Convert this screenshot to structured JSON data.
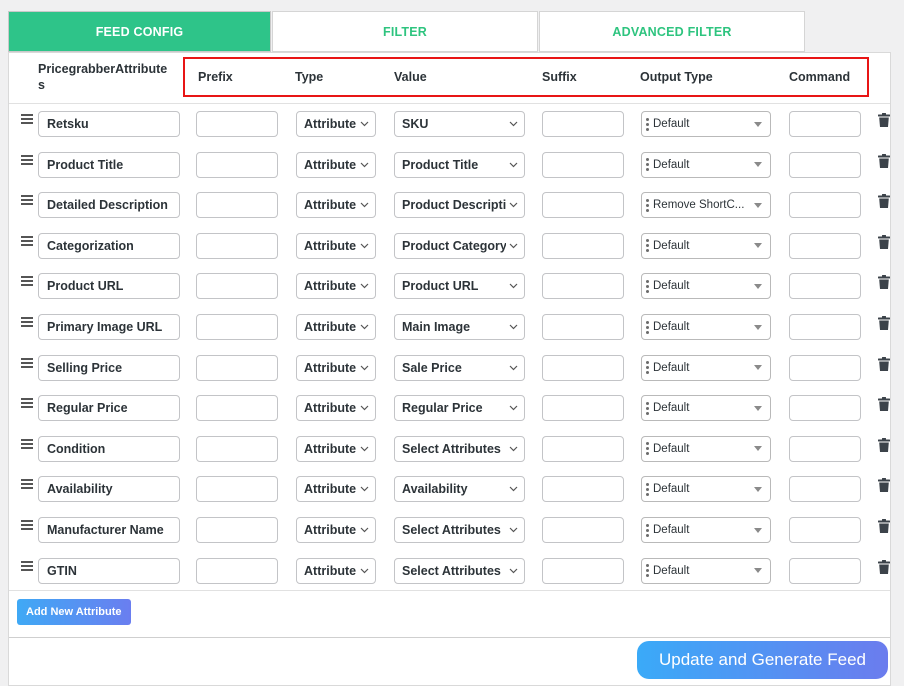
{
  "tabs": [
    {
      "label": "FEED CONFIG",
      "active": true
    },
    {
      "label": "FILTER",
      "active": false
    },
    {
      "label": "ADVANCED FILTER",
      "active": false
    }
  ],
  "columns": {
    "attribute": "PricegrabberAttribute\ns",
    "prefix": "Prefix",
    "type": "Type",
    "value": "Value",
    "suffix": "Suffix",
    "output_type": "Output Type",
    "command": "Command"
  },
  "rows": [
    {
      "attribute": "Retsku",
      "prefix": "",
      "type": "Attribute",
      "value": "SKU",
      "suffix": "",
      "output_type": "Default",
      "command": ""
    },
    {
      "attribute": "Product Title",
      "prefix": "",
      "type": "Attribute",
      "value": "Product Title",
      "suffix": "",
      "output_type": "Default",
      "command": ""
    },
    {
      "attribute": "Detailed Description",
      "prefix": "",
      "type": "Attribute",
      "value": "Product Description",
      "suffix": "",
      "output_type": "Remove ShortC...",
      "command": ""
    },
    {
      "attribute": "Categorization",
      "prefix": "",
      "type": "Attribute",
      "value": "Product Category",
      "suffix": "",
      "output_type": "Default",
      "command": ""
    },
    {
      "attribute": "Product URL",
      "prefix": "",
      "type": "Attribute",
      "value": "Product URL",
      "suffix": "",
      "output_type": "Default",
      "command": ""
    },
    {
      "attribute": "Primary Image URL",
      "prefix": "",
      "type": "Attribute",
      "value": "Main Image",
      "suffix": "",
      "output_type": "Default",
      "command": ""
    },
    {
      "attribute": "Selling Price",
      "prefix": "",
      "type": "Attribute",
      "value": "Sale Price",
      "suffix": "",
      "output_type": "Default",
      "command": ""
    },
    {
      "attribute": "Regular Price",
      "prefix": "",
      "type": "Attribute",
      "value": "Regular Price",
      "suffix": "",
      "output_type": "Default",
      "command": ""
    },
    {
      "attribute": "Condition",
      "prefix": "",
      "type": "Attribute",
      "value": "Select Attributes",
      "suffix": "",
      "output_type": "Default",
      "command": ""
    },
    {
      "attribute": "Availability",
      "prefix": "",
      "type": "Attribute",
      "value": "Availability",
      "suffix": "",
      "output_type": "Default",
      "command": ""
    },
    {
      "attribute": "Manufacturer Name",
      "prefix": "",
      "type": "Attribute",
      "value": "Select Attributes",
      "suffix": "",
      "output_type": "Default",
      "command": ""
    },
    {
      "attribute": "GTIN",
      "prefix": "",
      "type": "Attribute",
      "value": "Select Attributes",
      "suffix": "",
      "output_type": "Default",
      "command": ""
    }
  ],
  "buttons": {
    "add_attribute": "Add New Attribute",
    "generate": "Update and Generate Feed"
  },
  "icons": {
    "drag": "drag-handle-icon",
    "trash": "trash-icon",
    "chevron": "chevron-down-icon",
    "caret": "caret-down-icon"
  },
  "colors": {
    "active_tab": "#2ec489",
    "tab_text": "#2ec47f",
    "highlight_box": "#e81515",
    "button_gradient_start": "#3fa9f5",
    "button_gradient_end": "#6a7ef0"
  }
}
